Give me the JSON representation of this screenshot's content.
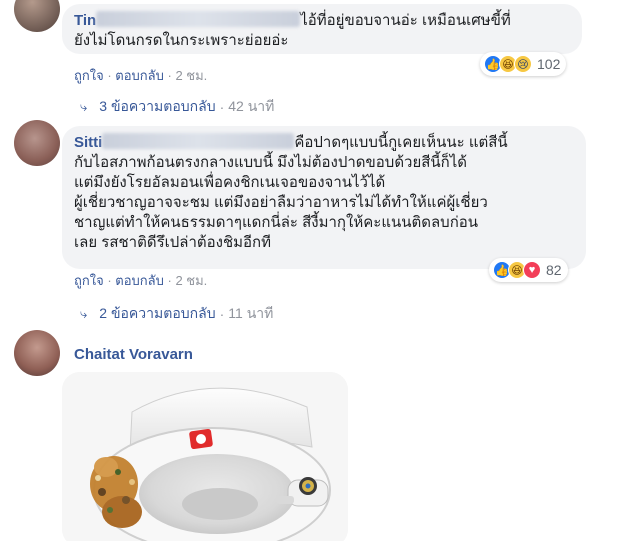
{
  "comments": [
    {
      "author": "Tin",
      "text": "ไอ้ที่อยู่ขอบจานอ่ะ เหมือนเศษขี้ที่\nยังไม่โดนกรดในกระเพราะย่อยอ่ะ",
      "actions": {
        "like": "ถูกใจ",
        "sep1": " · ",
        "reply": "ตอบกลับ",
        "sep2": " · ",
        "time": "2 ชม."
      },
      "reactions": {
        "icons": [
          "like-icon",
          "haha-icon",
          "sad-icon"
        ],
        "count": "102"
      },
      "replies": {
        "label": "3 ข้อความตอบกลับ",
        "sep": "·",
        "time": "42 นาที"
      }
    },
    {
      "author": "Sitti",
      "text": "คือปาดๆแบบนี้กูเคยเห็นนะ แต่สีนี้\nกับไอสภาพก้อนตรงกลางแบบนี้ มึงไม่ต้องปาดขอบด้วยสีนี้ก็ได้\nแต่มึงยังโรยอัลมอนเพื่อคงชิกเนเจอของจานไว้ได้\nผู้เชี่ยวชาญอาจจะชม แต่มึงอย่าลืมว่าอาหารไม่ได้ทำให้แค่ผู้เชี่ยว\nชาญแต่ทำให้คนธรรมดาๆแดกนี่ล่ะ สีงี้มากุให้คะแนนติดลบก่อน\nเลย รสชาติดีรึเปล่าต้องชิมอีกที",
      "actions": {
        "like": "ถูกใจ",
        "sep1": " · ",
        "reply": "ตอบกลับ",
        "sep2": " · ",
        "time": "2 ชม."
      },
      "reactions": {
        "icons": [
          "like-icon",
          "haha-icon",
          "love-icon"
        ],
        "count": "82"
      },
      "replies": {
        "label": "2 ข้อความตอบกลับ",
        "sep": "·",
        "time": "11 นาที"
      }
    },
    {
      "author": "Chaitat Voravarn"
    }
  ],
  "colors": {
    "link": "#385898",
    "muted": "#90949c",
    "bubble": "#f2f3f5",
    "like": "#2078f4",
    "love": "#f33e58",
    "haha": "#f7c843"
  }
}
